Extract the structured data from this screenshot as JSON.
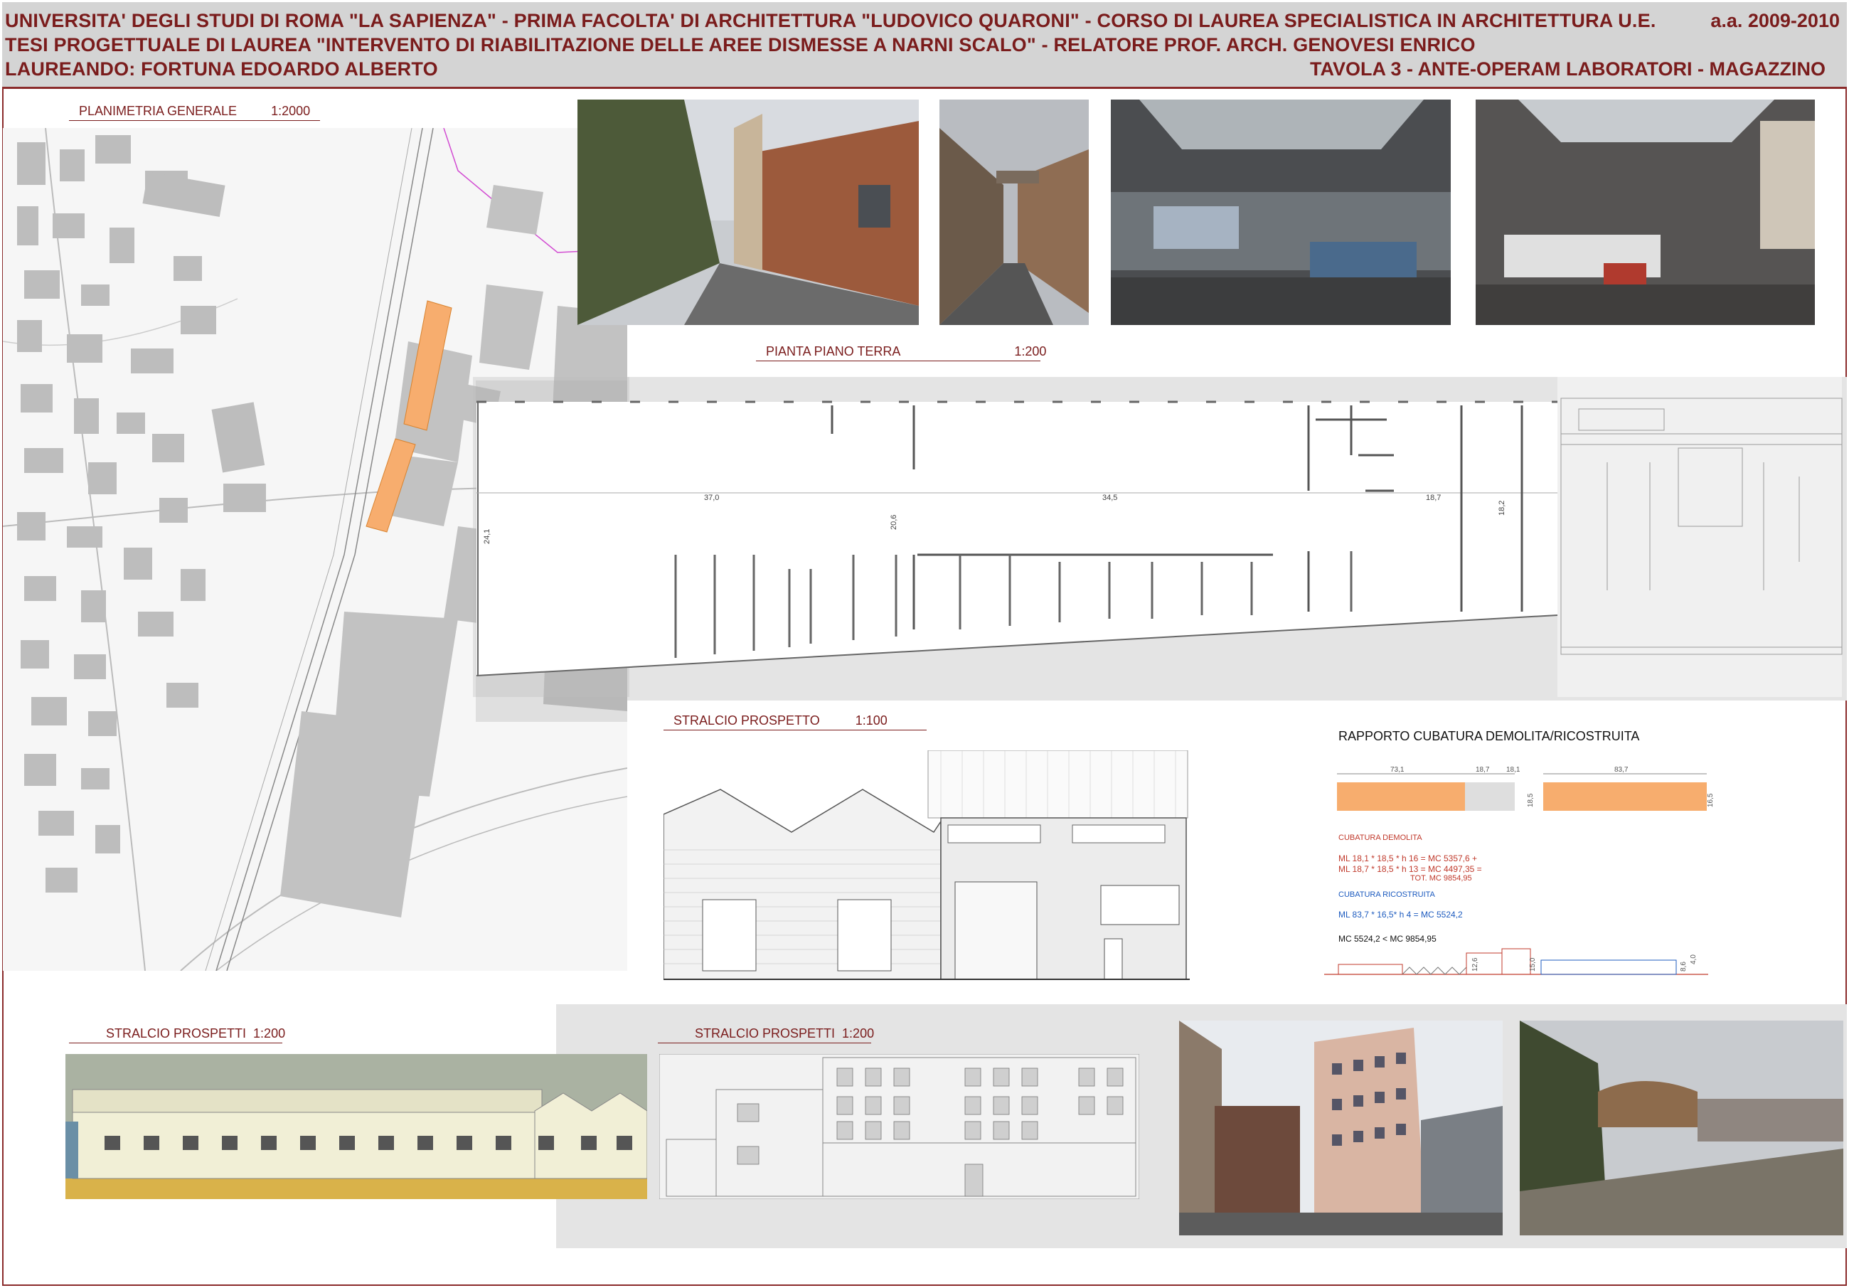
{
  "header": {
    "line1": "UNIVERSITA' DEGLI STUDI DI ROMA \"LA SAPIENZA\" - PRIMA FACOLTA' DI ARCHITETTURA \"LUDOVICO QUARONI\" - CORSO DI LAUREA SPECIALISTICA IN ARCHITETTURA U.E.",
    "year": "a.a. 2009-2010",
    "line2": "TESI PROGETTUALE DI LAUREA   \"INTERVENTO DI RIABILITAZIONE DELLE AREE DISMESSE A NARNI SCALO\" - RELATORE PROF. ARCH. GENOVESI ENRICO",
    "line3": "LAUREANDO: FORTUNA EDOARDO ALBERTO",
    "tavola": "TAVOLA 3 - ANTE-OPERAM LABORATORI - MAGAZZINO"
  },
  "sections": {
    "planimetria": {
      "title": "PLANIMETRIA GENERALE",
      "scale": "1:2000"
    },
    "pianta": {
      "title": "PIANTA PIANO TERRA",
      "scale": "1:200"
    },
    "prospetto": {
      "title": "STRALCIO PROSPETTO",
      "scale": "1:100"
    },
    "prospetti_a": {
      "title": "STRALCIO PROSPETTI",
      "scale": "1:200"
    },
    "prospetti_b": {
      "title": "STRALCIO PROSPETTI",
      "scale": "1:200"
    }
  },
  "plan_dims": {
    "d1": "37,0",
    "d2": "34,5",
    "d3": "18,7",
    "h1": "20,6",
    "h2": "18,2",
    "h3": "24,1"
  },
  "cubatura": {
    "title": "RAPPORTO CUBATURA DEMOLITA/RICOSTRUITA",
    "dim_a": "73,1",
    "dim_b": "18,7",
    "dim_c": "18,1",
    "dim_d": "83,7",
    "dim_e": "18,5",
    "dim_f": "16,5",
    "demolita_label": "CUBATURA DEMOLITA",
    "demolita_l1": "ML 18,1 * 18,5 * h 16 =  MC 5357,6   +",
    "demolita_l2": "ML  18,7 * 18,5 * h 13 = MC 4497,35 =",
    "demolita_tot": "TOT. MC 9854,95",
    "ricostruita_label": "CUBATURA RICOSTRUITA",
    "ricostruita_l1": "ML 83,7 * 16,5* h 4 =  MC 5524,2",
    "compare": "MC 5524,2 < MC 9854,95",
    "sec_h1": "12,6",
    "sec_h2": "15,0",
    "sec_h3": "8,6",
    "sec_h4": "4,0"
  },
  "colors": {
    "accent": "#7a1c1c",
    "highlight": "#f7ad6e",
    "band": "#e4e4e4"
  }
}
